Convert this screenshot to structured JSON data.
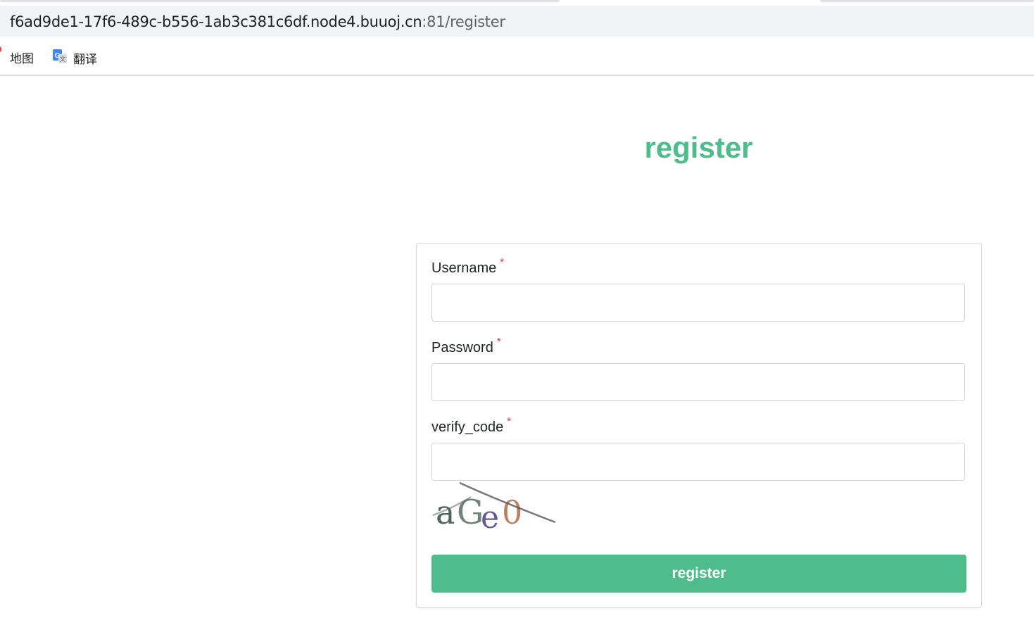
{
  "browser": {
    "url_host": "f6ad9de1-17f6-489c-b556-1ab3c381c6df.node4.buuoj.cn",
    "url_path": ":81/register"
  },
  "bookmarks": [
    {
      "label": "地图",
      "icon": "map-pin-icon"
    },
    {
      "label": "翻译",
      "icon": "google-translate-icon"
    }
  ],
  "page": {
    "title": "register"
  },
  "form": {
    "username_label": "Username",
    "password_label": "Password",
    "verify_label": "verify_code",
    "required_mark": "*",
    "username_value": "",
    "password_value": "",
    "verify_value": "",
    "captcha_text": "aGe0",
    "submit_label": "register"
  },
  "colors": {
    "accent": "#4fbd8b",
    "required": "#dc3545"
  }
}
